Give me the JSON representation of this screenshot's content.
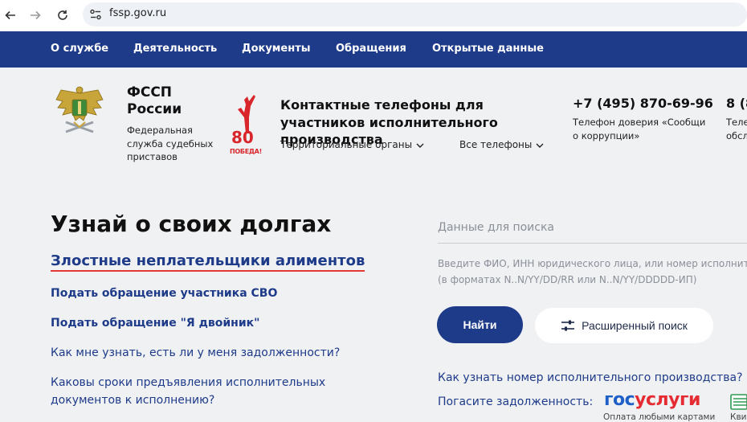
{
  "browser": {
    "url": "fssp.gov.ru"
  },
  "topnav": {
    "items": [
      "О службе",
      "Деятельность",
      "Документы",
      "Обращения",
      "Открытые данные"
    ]
  },
  "header": {
    "org_name_line1": "ФССП",
    "org_name_line2": "России",
    "org_subtitle": "Федеральная служба судебных приставов",
    "victory_text": "80",
    "victory_sub": "ПОБЕДА!",
    "contacts_title": "Контактные телефоны для участников исполнительного производства",
    "dropdown_regions": "Территориальные органы",
    "dropdown_phones": "Все телефоны",
    "phone1": "+7 (495) 870-69-96",
    "phone1_desc": "Телефон доверия «Сообщи о коррупции»",
    "phone2": "8 (8",
    "phone2_desc_line1": "Теле",
    "phone2_desc_line2": "обсл"
  },
  "main": {
    "title": "Узнай о своих долгах",
    "alimony_link": "Злостные неплательщики алиментов",
    "link_svo": "Подать обращение участника СВО",
    "link_double": "Подать обращение \"Я двойник\"",
    "faq1": "Как мне узнать, есть ли у меня задолженности?",
    "faq2_line1": "Каковы сроки предъявления исполнительных",
    "faq2_line2": "документов к исполнению?"
  },
  "search": {
    "placeholder": "Данные для поиска",
    "hint_line1": "Введите ФИО, ИНН юридического лица, или номер исполнит",
    "hint_line2": "(в форматах N..N/YY/DD/RR или N..N/YY/DDDDD-ИП)",
    "find_button": "Найти",
    "advanced_button": "Расширенный поиск",
    "how_to_link": "Как узнать номер исполнительного производства?",
    "pay_label": "Погасите задолженность:",
    "gos_part1": "гос",
    "gos_part2": "услуги",
    "gos_sub": "Оплата любыми картами",
    "kvit_label": "Кви"
  },
  "colors": {
    "nav_bg": "#1e3b8a",
    "link": "#1e3b8a",
    "page_bg": "#f0f1f3",
    "alimony_underline": "#e53935"
  }
}
